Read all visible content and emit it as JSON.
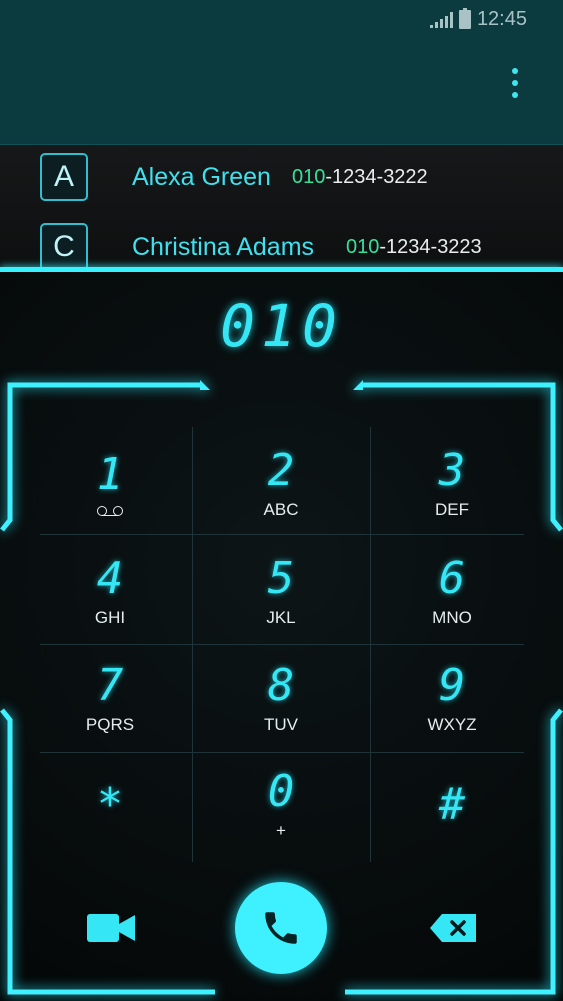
{
  "status_bar": {
    "time": "12:45"
  },
  "contacts": [
    {
      "letter": "A",
      "name": "Alexa Green",
      "number_prefix": "010",
      "number_rest": "-1234-3222"
    },
    {
      "letter": "C",
      "name": "Christina Adams",
      "number_prefix": "010",
      "number_rest": "-1234-3223"
    }
  ],
  "dial": {
    "entered": "010"
  },
  "keys": [
    {
      "digit": "1",
      "letters": ""
    },
    {
      "digit": "2",
      "letters": "ABC"
    },
    {
      "digit": "3",
      "letters": "DEF"
    },
    {
      "digit": "4",
      "letters": "GHI"
    },
    {
      "digit": "5",
      "letters": "JKL"
    },
    {
      "digit": "6",
      "letters": "MNO"
    },
    {
      "digit": "7",
      "letters": "PQRS"
    },
    {
      "digit": "8",
      "letters": "TUV"
    },
    {
      "digit": "9",
      "letters": "WXYZ"
    },
    {
      "digit": "*",
      "letters": ""
    },
    {
      "digit": "0",
      "letters": "+"
    },
    {
      "digit": "#",
      "letters": ""
    }
  ],
  "icons": {
    "more": "more-vert-icon",
    "voicemail": "voicemail-icon",
    "video": "video-call-icon",
    "call": "phone-icon",
    "backspace": "backspace-icon"
  },
  "colors": {
    "accent": "#35e7f4",
    "header": "#0b3a3f",
    "number_highlight": "#34e29a"
  }
}
